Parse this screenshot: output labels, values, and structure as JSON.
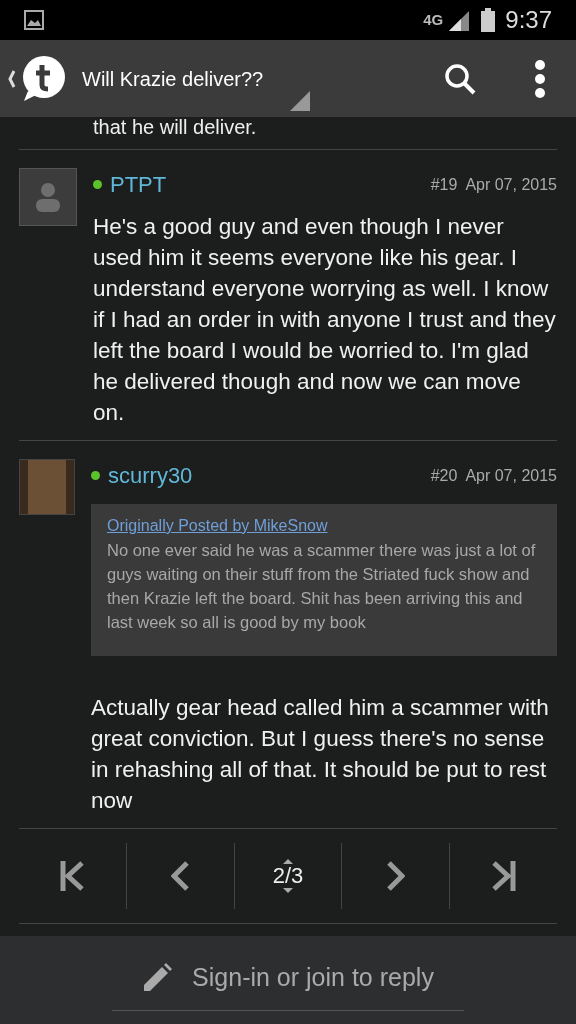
{
  "status_bar": {
    "network": "4G",
    "time": "9:37"
  },
  "header": {
    "title": "Will Krazie deliver??"
  },
  "previous_text": "that he will deliver.",
  "posts": [
    {
      "username": "PTPT",
      "online": true,
      "kind": "default",
      "number": "#19",
      "date": "Apr 07, 2015",
      "body": "He's a good guy and even though I never used him it seems everyone like his gear. I understand everyone worrying as well. I know if I had an order in with anyone I trust and they left the board I would be worried to. I'm glad he delivered though and now we can move on."
    },
    {
      "username": "scurry30",
      "online": true,
      "kind": "photo",
      "number": "#20",
      "date": "Apr 07, 2015",
      "quote": {
        "link": "Originally Posted by MikeSnow",
        "text": "No one ever said he was a scammer there was just a lot of guys waiting on their stuff from the Striated fuck show and then Krazie left the board. Shit has been arriving this and last week so all is good by my book"
      },
      "body": "Actually gear head called him a scammer with great conviction. But I guess there's no sense in rehashing all of that. It should be put to rest now"
    }
  ],
  "pagination": {
    "page": "2/3"
  },
  "reply_bar": {
    "label": "Sign-in or join to reply"
  }
}
